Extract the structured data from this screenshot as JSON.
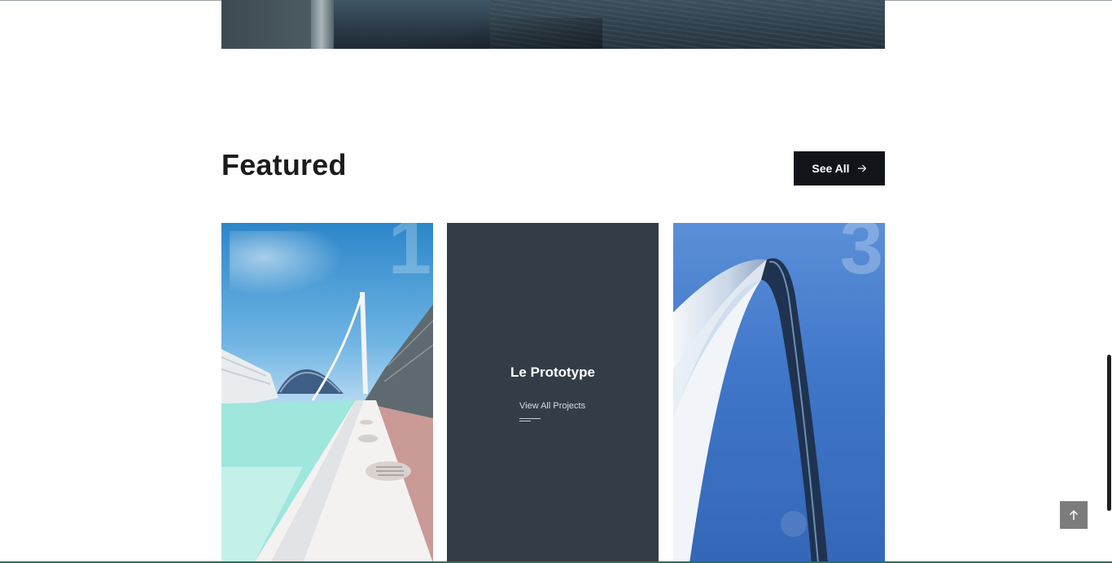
{
  "featured": {
    "title": "Featured",
    "see_all_label": "See All"
  },
  "cards": [
    {
      "number": "1",
      "image": "modern white architecture with bridge and pool"
    },
    {
      "title": "Le Prototype",
      "link_label": "View All Projects"
    },
    {
      "number": "3",
      "image": "steel arch against blue sky"
    }
  ],
  "icons": {
    "see_all": "arrow-right-icon",
    "scroll_top": "arrow-up-icon"
  },
  "colors": {
    "button_bg": "#111418",
    "card_dark": "#333d48",
    "scroll_top_bg": "#7c7c7c"
  }
}
